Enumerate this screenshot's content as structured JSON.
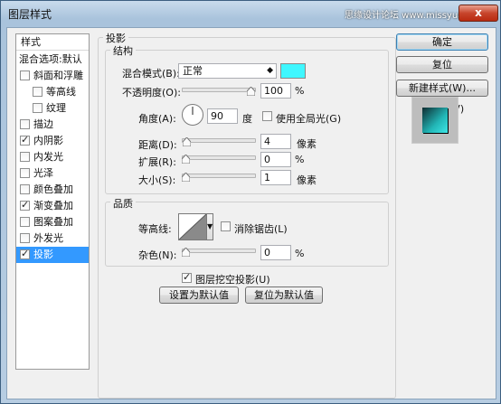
{
  "window": {
    "title": "图层样式",
    "watermark": "思缘设计论坛 www.missyuan.com",
    "close_label": "x"
  },
  "left_panel": {
    "header": "样式",
    "items": [
      {
        "label": "混合选项:默认",
        "checkbox": false,
        "checked": false,
        "indent": 0,
        "selected": false
      },
      {
        "label": "斜面和浮雕",
        "checkbox": true,
        "checked": false,
        "indent": 0,
        "selected": false
      },
      {
        "label": "等高线",
        "checkbox": true,
        "checked": false,
        "indent": 1,
        "selected": false
      },
      {
        "label": "纹理",
        "checkbox": true,
        "checked": false,
        "indent": 1,
        "selected": false
      },
      {
        "label": "描边",
        "checkbox": true,
        "checked": false,
        "indent": 0,
        "selected": false
      },
      {
        "label": "内阴影",
        "checkbox": true,
        "checked": true,
        "indent": 0,
        "selected": false
      },
      {
        "label": "内发光",
        "checkbox": true,
        "checked": false,
        "indent": 0,
        "selected": false
      },
      {
        "label": "光泽",
        "checkbox": true,
        "checked": false,
        "indent": 0,
        "selected": false
      },
      {
        "label": "颜色叠加",
        "checkbox": true,
        "checked": false,
        "indent": 0,
        "selected": false
      },
      {
        "label": "渐变叠加",
        "checkbox": true,
        "checked": true,
        "indent": 0,
        "selected": false
      },
      {
        "label": "图案叠加",
        "checkbox": true,
        "checked": false,
        "indent": 0,
        "selected": false
      },
      {
        "label": "外发光",
        "checkbox": true,
        "checked": false,
        "indent": 0,
        "selected": false
      },
      {
        "label": "投影",
        "checkbox": true,
        "checked": true,
        "indent": 0,
        "selected": true
      }
    ]
  },
  "drop_shadow": {
    "section_title": "投影",
    "structure_title": "结构",
    "blend_mode_label": "混合模式(B):",
    "blend_mode_value": "正常",
    "blend_color": "#3ff7ff",
    "opacity_label": "不透明度(O):",
    "opacity_value": "100",
    "opacity_unit": "%",
    "opacity_fraction": 1.0,
    "angle_label": "角度(A):",
    "angle_value": "90",
    "angle_unit": "度",
    "global_light_label": "使用全局光(G)",
    "global_light_checked": false,
    "distance_label": "距离(D):",
    "distance_value": "4",
    "distance_unit": "像素",
    "distance_fraction": 0.02,
    "spread_label": "扩展(R):",
    "spread_value": "0",
    "spread_unit": "%",
    "spread_fraction": 0.0,
    "size_label": "大小(S):",
    "size_value": "1",
    "size_unit": "像素",
    "size_fraction": 0.0,
    "quality_title": "品质",
    "contour_label": "等高线:",
    "antialias_label": "消除锯齿(L)",
    "antialias_checked": false,
    "noise_label": "杂色(N):",
    "noise_value": "0",
    "noise_unit": "%",
    "noise_fraction": 0.0,
    "knockout_label": "图层挖空投影(U)",
    "knockout_checked": true,
    "set_default_label": "设置为默认值",
    "reset_default_label": "复位为默认值"
  },
  "right_buttons": {
    "ok_label": "确定",
    "reset_label": "复位",
    "new_style_label": "新建样式(W)...",
    "preview_label": "预览(V)",
    "preview_checked": true
  },
  "check_glyph": "✓"
}
